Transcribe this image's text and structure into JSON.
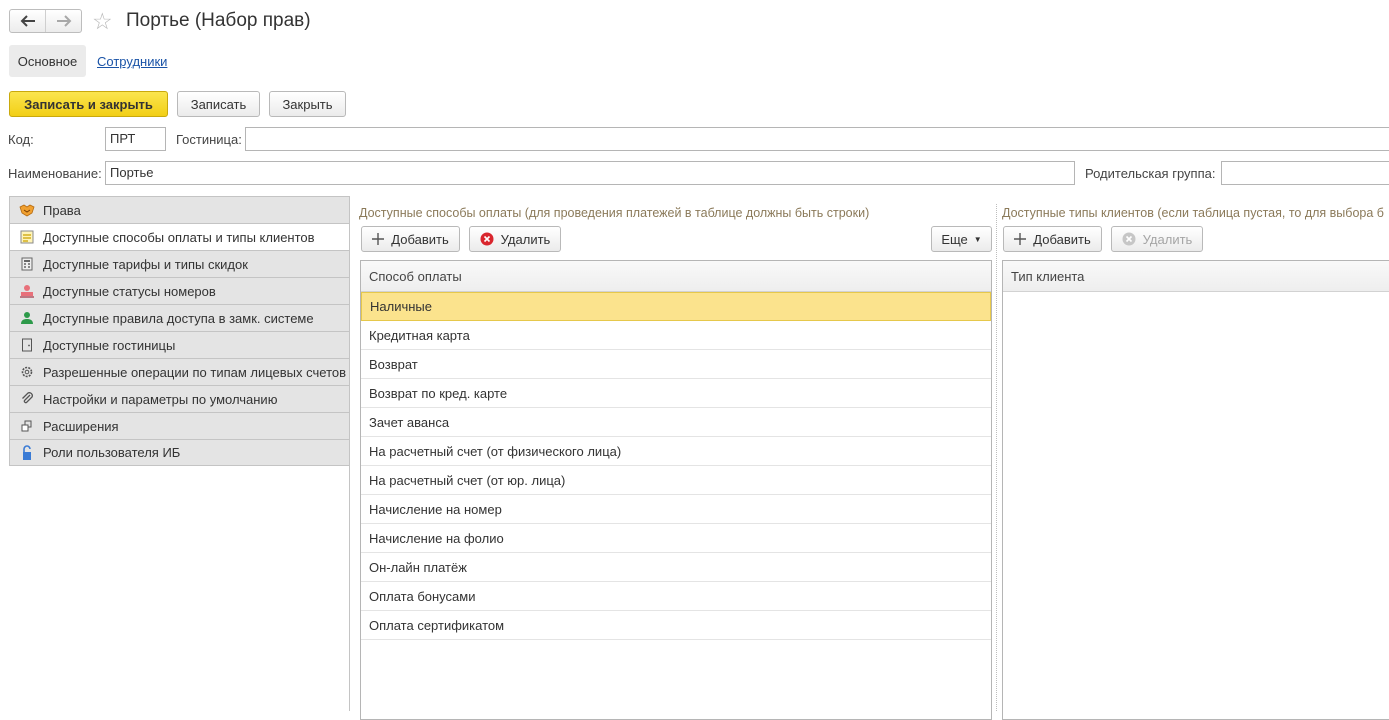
{
  "window": {
    "title": "Портье (Набор прав)",
    "back_icon": "arrow-left-icon",
    "forward_icon": "arrow-right-icon",
    "favorite_icon": "star-icon"
  },
  "section_tabs": {
    "main": "Основное",
    "employees": "Сотрудники"
  },
  "command_bar": {
    "save_close": "Записать и закрыть",
    "save": "Записать",
    "close": "Закрыть"
  },
  "fields": {
    "code_label": "Код:",
    "code_value": "ПРТ",
    "hotel_label": "Гостиница:",
    "hotel_value": "",
    "name_label": "Наименование:",
    "name_value": "Портье",
    "parent_label": "Родительская группа:",
    "parent_value": ""
  },
  "left_tabs": [
    {
      "label": "Права",
      "icon": "handshake-icon"
    },
    {
      "label": "Доступные способы оплаты и типы клиентов",
      "icon": "payment-doc-icon"
    },
    {
      "label": "Доступные тарифы и типы скидок",
      "icon": "calculator-icon"
    },
    {
      "label": "Доступные статусы номеров",
      "icon": "bed-icon"
    },
    {
      "label": "Доступные правила доступа в замк. системе",
      "icon": "person-lock-icon"
    },
    {
      "label": "Доступные гостиницы",
      "icon": "door-icon"
    },
    {
      "label": "Разрешенные операции по типам лицевых счетов",
      "icon": "gear-icon"
    },
    {
      "label": "Настройки и параметры по умолчанию",
      "icon": "paperclip-icon"
    },
    {
      "label": "Расширения",
      "icon": "extension-icon"
    },
    {
      "label": "Роли пользователя ИБ",
      "icon": "padlock-icon"
    }
  ],
  "payments": {
    "title": "Доступные способы оплаты (для проведения платежей в таблице должны быть строки)",
    "add": "Добавить",
    "delete": "Удалить",
    "more": "Еще",
    "column": "Способ оплаты",
    "rows": [
      "Наличные",
      "Кредитная карта",
      "Возврат",
      "Возврат по кред. карте",
      "Зачет аванса",
      "На расчетный счет (от физического лица)",
      "На расчетный счет (от юр. лица)",
      "Начисление на номер",
      "Начисление на фолио",
      "Он-лайн платёж",
      "Оплата бонусами",
      "Оплата сертификатом"
    ]
  },
  "clients": {
    "title": "Доступные типы клиентов (если таблица пустая, то для выбора б",
    "add": "Добавить",
    "delete": "Удалить",
    "column": "Тип клиента"
  },
  "colors": {
    "accent_yellow": "#f2cf16",
    "selected_row": "#fbe38d",
    "link": "#1a53a7",
    "group_title": "#8b7a5a"
  }
}
